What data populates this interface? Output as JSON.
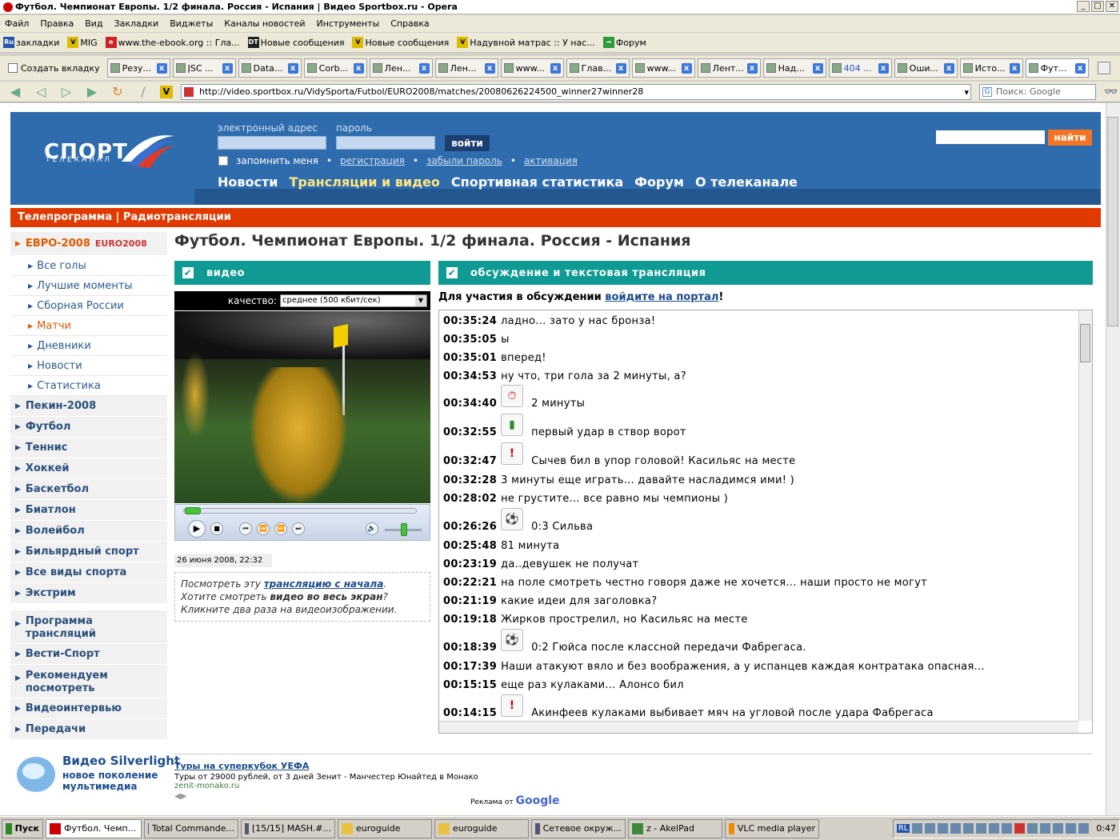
{
  "window": {
    "title": "Футбол. Чемпионат Европы. 1/2 финала. Россия - Испания | Видео Sportbox.ru - Opera"
  },
  "menu": [
    "Файл",
    "Правка",
    "Вид",
    "Закладки",
    "Виджеты",
    "Каналы новостей",
    "Инструменты",
    "Справка"
  ],
  "bookmarks": [
    {
      "icon": "Ru",
      "label": "закладки"
    },
    {
      "icon": "V",
      "label": "MIG"
    },
    {
      "icon": "e",
      "label": "www.the-ebook.org :: Гла..."
    },
    {
      "icon": "DT",
      "label": "Новые сообщения"
    },
    {
      "icon": "V",
      "label": "Новые сообщения"
    },
    {
      "icon": "V",
      "label": "Надувной матрас :: У нас..."
    },
    {
      "icon": "→",
      "label": "Форум"
    }
  ],
  "tabs": {
    "new_tab": "Создать вкладку",
    "items": [
      "Резу...",
      "JSC ...",
      "Data...",
      "Corb...",
      "Лен...",
      "Лен...",
      "www...",
      "Глав...",
      "www...",
      "Лент...",
      "Над...",
      "404 ...",
      "Оши...",
      "Исто...",
      "Фут..."
    ]
  },
  "address": {
    "url": "http://video.sportbox.ru/VidySporta/Futbol/EURO2008/matches/20080626224500_winner27winner28",
    "search_placeholder": "Поиск: Google"
  },
  "header": {
    "logo": "СПОРТ",
    "logo_sub": "ТЕЛЕКАНАЛ",
    "email_label": "электронный адрес",
    "password_label": "пароль",
    "login_button": "войти",
    "remember": "запомнить меня",
    "links": [
      "регистрация",
      "забыли пароль",
      "активация"
    ],
    "search_button": "найти",
    "nav": [
      "Новости",
      "Трансляции и видео",
      "Спортивная статистика",
      "Форум",
      "О телеканале"
    ],
    "subnav": "Телепрограмма  |  Радиотрансляции"
  },
  "sidebar": {
    "euro": "ЕВРО-2008",
    "euro_logo": "EURO2008",
    "sub": [
      "Все голы",
      "Лучшие моменты",
      "Сборная России",
      "Матчи",
      "Дневники",
      "Новости",
      "Статистика"
    ],
    "main": [
      "Пекин-2008",
      "Футбол",
      "Теннис",
      "Хоккей",
      "Баскетбол",
      "Биатлон",
      "Волейбол",
      "Бильярдный спорт",
      "Все виды спорта",
      "Экстрим"
    ],
    "extra": [
      "Программа трансляций",
      "Вести-Спорт",
      "Рекомендуем посмотреть",
      "Видеоинтервью",
      "Передачи"
    ],
    "silverlight_title": "Видео Silverlight",
    "silverlight_sub": "новое поколение мультимедиа"
  },
  "content": {
    "title": "Футбол. Чемпионат Европы. 1/2 финала. Россия - Испания",
    "video_bar": "видео",
    "discussion_bar": "обсуждение и текстовая трансляция",
    "quality_label": "качество:",
    "quality_value": "среднее (500 кбит/сек)",
    "video_date": "26 июня 2008, 22:32",
    "note_1": "Посмотреть эту ",
    "note_link": "трансляцию с начала",
    "note_2": "Хотите смотреть ",
    "note_bold": "видео во весь экран",
    "note_3": "Кликните два раза на видеоизображении.",
    "participate": "Для участия в обсуждении ",
    "participate_link": "войдите на портал"
  },
  "chat": [
    {
      "time": "00:35:24",
      "text": "ладно... зато у нас бронза!"
    },
    {
      "time": "00:35:05",
      "text": "ы"
    },
    {
      "time": "00:35:01",
      "text": "вперед!"
    },
    {
      "time": "00:34:53",
      "text": "ну что, три гола за 2 минуты, а?"
    },
    {
      "time": "00:34:40",
      "text": "2 минуты",
      "icon": "timer-icon"
    },
    {
      "time": "00:32:55",
      "text": "первый удар в створ ворот",
      "icon": "stats-icon"
    },
    {
      "time": "00:32:47",
      "text": "Сычев бил в упор головой! Касильяс на месте",
      "icon": "alert-icon"
    },
    {
      "time": "00:32:28",
      "text": "3 минуты еще играть... давайте насладимся ими! )"
    },
    {
      "time": "00:28:02",
      "text": "не грустите... все равно мы чемпионы )"
    },
    {
      "time": "00:26:26",
      "text": "0:3 Сильва",
      "icon": "ball-icon"
    },
    {
      "time": "00:25:48",
      "text": "81 минута"
    },
    {
      "time": "00:23:19",
      "text": "да..девушек не получат"
    },
    {
      "time": "00:22:21",
      "text": "на поле смотреть честно говоря даже не хочется... наши просто не могут"
    },
    {
      "time": "00:21:19",
      "text": "какие идеи для заголовка?"
    },
    {
      "time": "00:19:18",
      "text": "Жирков прострелил, но Касильяс на месте"
    },
    {
      "time": "00:18:39",
      "text": "0:2 Гюйса после классной передачи Фабрегаса.",
      "icon": "ball-icon"
    },
    {
      "time": "00:17:39",
      "text": "Наши атакуют вяло и без воображения, а у испанцев каждая контратака опасная..."
    },
    {
      "time": "00:15:15",
      "text": "еще раз кулаками... Алонсо бил"
    },
    {
      "time": "00:14:15",
      "text": "Акинфеев кулаками выбивает мяч на угловой после удара Фабрегаса",
      "icon": "alert-icon"
    }
  ],
  "ad": {
    "headline": "Туры на суперкубок УЕФА",
    "desc": "Туры от 29000 рублей, от 3 дней Зенит - Манчестер Юнайтед в Монако",
    "url": "zenit-monako.ru",
    "by": "Реклама от",
    "by_brand": "Google"
  },
  "taskbar": {
    "start": "Пуск",
    "items": [
      "Футбол. Чемп...",
      "Total Commande...",
      "[15/15] MASH.#...",
      "euroguide",
      "euroguide",
      "Сетевое окруж...",
      "z - AkelPad",
      "VLC media player"
    ],
    "lang": "RL",
    "clock": "0:47"
  }
}
